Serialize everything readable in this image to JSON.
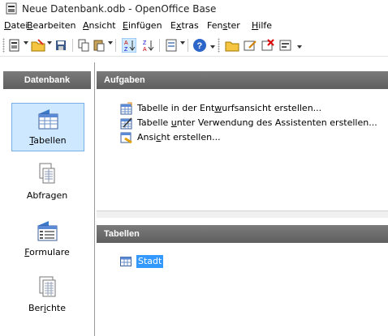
{
  "window": {
    "title": "Neue Datenbank.odb - OpenOffice Base"
  },
  "menubar": {
    "items": [
      {
        "pre": "",
        "key": "D",
        "post": "atei"
      },
      {
        "pre": "",
        "key": "B",
        "post": "earbeiten"
      },
      {
        "pre": "",
        "key": "A",
        "post": "nsicht"
      },
      {
        "pre": "",
        "key": "E",
        "post": "infügen"
      },
      {
        "pre": "E",
        "key": "x",
        "post": "tras"
      },
      {
        "pre": "Fen",
        "key": "s",
        "post": "ter"
      },
      {
        "pre": "",
        "key": "H",
        "post": "ilfe"
      }
    ]
  },
  "left_pane": {
    "header": "Datenbank",
    "items": [
      {
        "pre": "",
        "key": "T",
        "post": "abellen",
        "icon": "table-icon",
        "selected": true
      },
      {
        "pre": "Abfragen",
        "key": "",
        "post": "",
        "icon": "query-icon",
        "selected": false
      },
      {
        "pre": "",
        "key": "F",
        "post": "ormulare",
        "icon": "form-icon",
        "selected": false
      },
      {
        "pre": "Ber",
        "key": "i",
        "post": "chte",
        "icon": "report-icon",
        "selected": false
      }
    ]
  },
  "tasks_pane": {
    "header": "Aufgaben",
    "tasks": [
      {
        "pre": "Tabelle in der Ent",
        "key": "w",
        "post": "urfsansicht erstellen...",
        "icon": "table-design-icon"
      },
      {
        "pre": "Tabelle ",
        "key": "u",
        "post": "nter Verwendung des Assistenten erstellen...",
        "icon": "table-wizard-icon"
      },
      {
        "pre": "Ansi",
        "key": "c",
        "post": "ht erstellen...",
        "icon": "create-view-icon"
      }
    ]
  },
  "tables_pane": {
    "header": "Tabellen",
    "items": [
      {
        "label": "Stadt",
        "selected": true
      }
    ]
  },
  "colors": {
    "header_bg": "#6b6b6b",
    "selected_nav_bg": "#cde8ff",
    "selection_bg": "#3399ff"
  }
}
